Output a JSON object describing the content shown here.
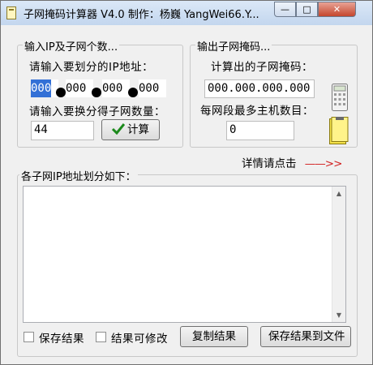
{
  "window": {
    "title": "子网掩码计算器 V4.0  制作：杨巍 YangWei66.Y...",
    "min_glyph": "—",
    "max_glyph": "□",
    "close_glyph": "✕"
  },
  "input_group": {
    "title": "输入IP及子网个数...",
    "ip_label": "请输入要划分的IP地址：",
    "ip_octets": [
      "000",
      "000",
      "000",
      "000"
    ],
    "count_label": "请输入要换分得子网数量：",
    "count_value": "44",
    "calc_button": "计算",
    "calc_icon": "check-icon"
  },
  "output_group": {
    "title": "输出子网掩码...",
    "mask_label": "计算出的子网掩码：",
    "mask_value": "000.000.000.000",
    "hosts_label": "每网段最多主机数目：",
    "hosts_value": "0"
  },
  "details_link": {
    "label": "详情请点击",
    "arrow": "——>>"
  },
  "result_group": {
    "title": "各子网IP地址划分如下：",
    "content": ""
  },
  "bottom": {
    "save_result_label": "保存结果",
    "editable_label": "结果可修改",
    "copy_button": "复制结果",
    "save_file_button": "保存结果到文件"
  },
  "colors": {
    "accent_red": "#d22020",
    "selection": "#3370d6"
  }
}
